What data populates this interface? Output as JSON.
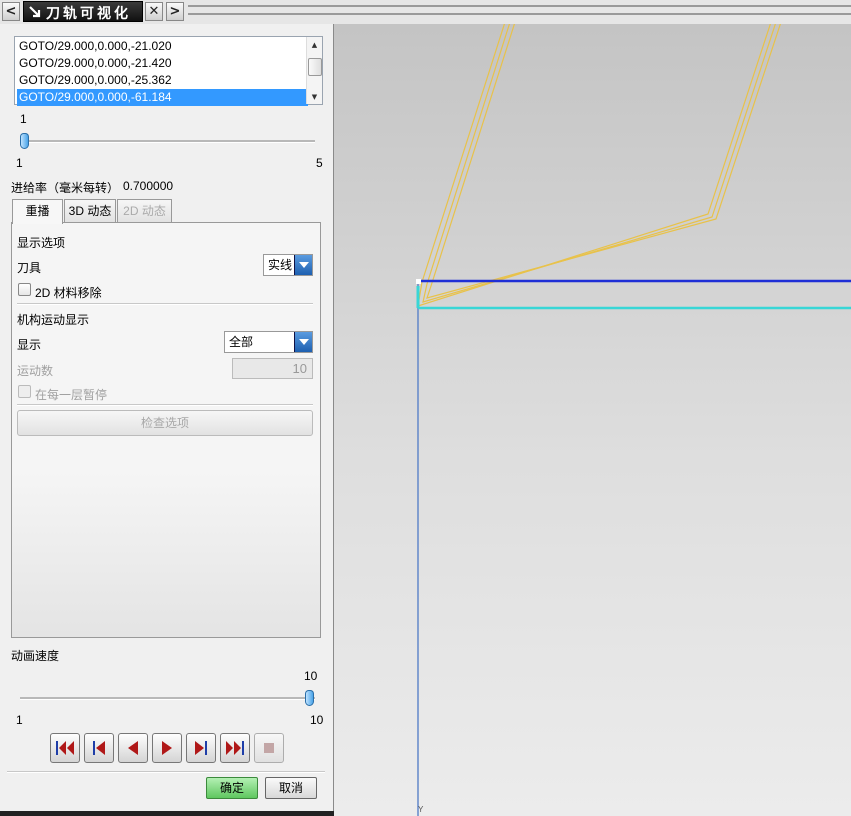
{
  "window": {
    "title": "刀轨可视化",
    "nav_prev": "<",
    "nav_next": ">",
    "close": "✕"
  },
  "toolpath_list": {
    "rows": [
      "GOTO/29.000,0.000,-21.020",
      "GOTO/29.000,0.000,-21.420",
      "GOTO/29.000,0.000,-25.362",
      "GOTO/29.000,0.000,-61.184"
    ],
    "selected_index": 3
  },
  "step_slider": {
    "value_label": "1",
    "min_label": "1",
    "max_label": "5",
    "value": 1,
    "min": 1,
    "max": 5
  },
  "feed_rate": {
    "label": "进给率（毫米每转）",
    "value": "0.700000"
  },
  "tabs": [
    {
      "label": "重播",
      "active": true,
      "enabled": true
    },
    {
      "label": "3D 动态",
      "active": false,
      "enabled": true
    },
    {
      "label": "2D 动态",
      "active": false,
      "enabled": false
    }
  ],
  "display_options": {
    "heading": "显示选项",
    "tool_label": "刀具",
    "tool_value": "实线",
    "material_removal_label": "2D 材料移除",
    "material_removal_checked": false
  },
  "motion_display": {
    "heading": "机构运动显示",
    "display_label": "显示",
    "display_value": "全部",
    "motion_count_label": "运动数",
    "motion_count_value": "10",
    "pause_each_layer_label": "在每一层暂停",
    "pause_each_layer_checked": false,
    "check_options_button": "检查选项"
  },
  "animation_speed": {
    "label": "动画速度",
    "value_label": "10",
    "min_label": "1",
    "max_label": "10",
    "value": 10,
    "min": 1,
    "max": 10
  },
  "playback_buttons": [
    {
      "name": "rewind-to-start-button",
      "icon": "skip-to-start-icon"
    },
    {
      "name": "step-back-button",
      "icon": "step-backward-icon"
    },
    {
      "name": "play-reverse-button",
      "icon": "play-reverse-icon"
    },
    {
      "name": "play-button",
      "icon": "play-icon"
    },
    {
      "name": "step-forward-button",
      "icon": "step-forward-icon"
    },
    {
      "name": "skip-to-end-button",
      "icon": "skip-to-end-icon"
    },
    {
      "name": "stop-button",
      "icon": "stop-icon",
      "enabled": false
    }
  ],
  "dialog": {
    "ok_label": "确定",
    "cancel_label": "取消"
  },
  "viewport": {
    "axis_label": "Y"
  },
  "colors": {
    "toolpath": "#e8c24a",
    "cut_line": "#1f2fd6",
    "stock_line": "#38d6d6",
    "axis": "#5a82c8",
    "selection": "#3399ff"
  }
}
